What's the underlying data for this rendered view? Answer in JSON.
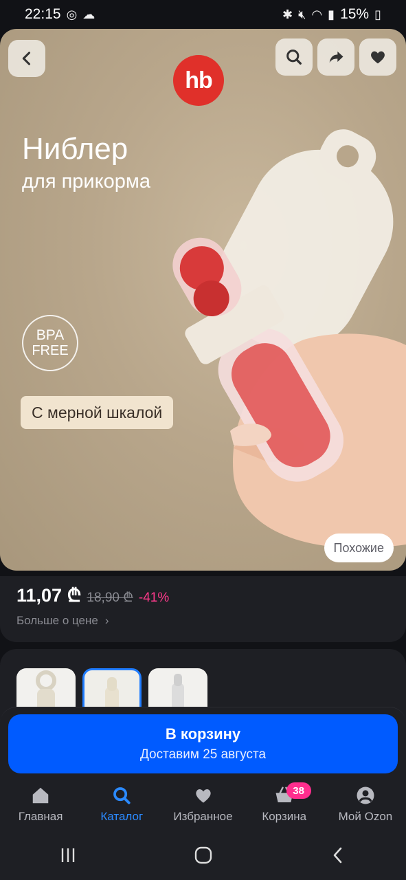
{
  "status_bar": {
    "time": "22:15",
    "battery": "15%"
  },
  "hero": {
    "brand": "hb",
    "title": "Ниблер",
    "subtitle": "для прикорма",
    "bpa_line1": "BPA",
    "bpa_line2": "FREE",
    "badge": "С мерной шкалой",
    "similar_label": "Похожие",
    "icons": {
      "back": "chevron-left-icon",
      "search": "search-icon",
      "share": "share-icon",
      "favorite": "heart-icon"
    }
  },
  "price": {
    "current": "11,07 ₾",
    "old": "18,90 ₾",
    "discount": "-41%",
    "more_label": "Больше о цене"
  },
  "thumbnails": {
    "count": 3,
    "active_index": 1
  },
  "cta": {
    "label": "В корзину",
    "delivery": "Доставим 25 августа",
    "color": "#005bff"
  },
  "bottom_nav": {
    "items": [
      {
        "label": "Главная",
        "icon": "home-icon"
      },
      {
        "label": "Каталог",
        "icon": "search-icon",
        "active": true
      },
      {
        "label": "Избранное",
        "icon": "heart-icon"
      },
      {
        "label": "Корзина",
        "icon": "basket-icon",
        "badge": "38"
      },
      {
        "label": "Мой Ozon",
        "icon": "profile-icon"
      }
    ]
  },
  "colors": {
    "accent": "#2b8aff",
    "badge": "#ff2e8e",
    "discount": "#ff3a8c",
    "brand": "#e0302a"
  }
}
